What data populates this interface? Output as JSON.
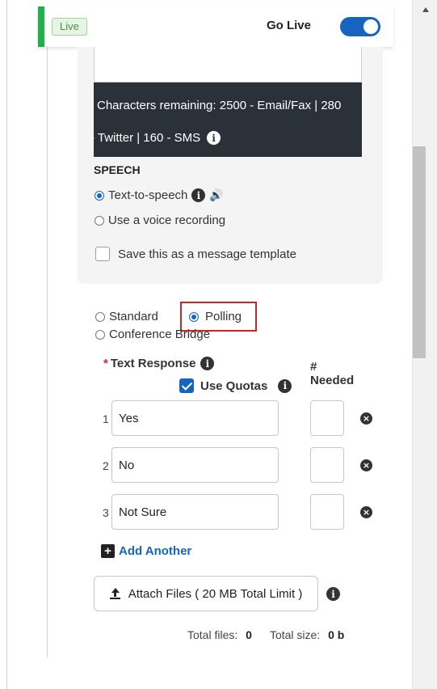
{
  "header": {
    "status_badge": "Live",
    "go_live_label": "Go Live",
    "go_live_on": true,
    "accent_color": "#1fb14a",
    "toggle_color": "#1565c0"
  },
  "message": {
    "chars_line1": "Characters remaining: 2500 - Email/Fax  |  280",
    "chars_line2": "- Twitter  |  160 - SMS"
  },
  "speech": {
    "title": "SPEECH",
    "options": [
      {
        "label": "Text-to-speech",
        "selected": true
      },
      {
        "label": "Use a voice recording",
        "selected": false
      }
    ],
    "save_template_label": "Save this as a message template",
    "save_template_checked": false
  },
  "message_type": {
    "options": [
      {
        "label": "Standard",
        "selected": false
      },
      {
        "label": "Polling",
        "selected": true
      },
      {
        "label": "Conference Bridge",
        "selected": false
      }
    ]
  },
  "responses": {
    "required_mark": "*",
    "title": "Text Response",
    "use_quotas_label": "Use Quotas",
    "use_quotas_checked": true,
    "needed_header_line1": "#",
    "needed_header_line2": "Needed",
    "items": [
      {
        "num": "1",
        "value": "Yes",
        "needed": ""
      },
      {
        "num": "2",
        "value": "No",
        "needed": ""
      },
      {
        "num": "3",
        "value": "Not Sure",
        "needed": ""
      }
    ],
    "add_label": "Add Another"
  },
  "attachments": {
    "button_label": "Attach Files ( 20 MB Total Limit )",
    "total_files_label": "Total files:",
    "total_files_value": "0",
    "total_size_label": "Total size:",
    "total_size_value": "0 b"
  }
}
